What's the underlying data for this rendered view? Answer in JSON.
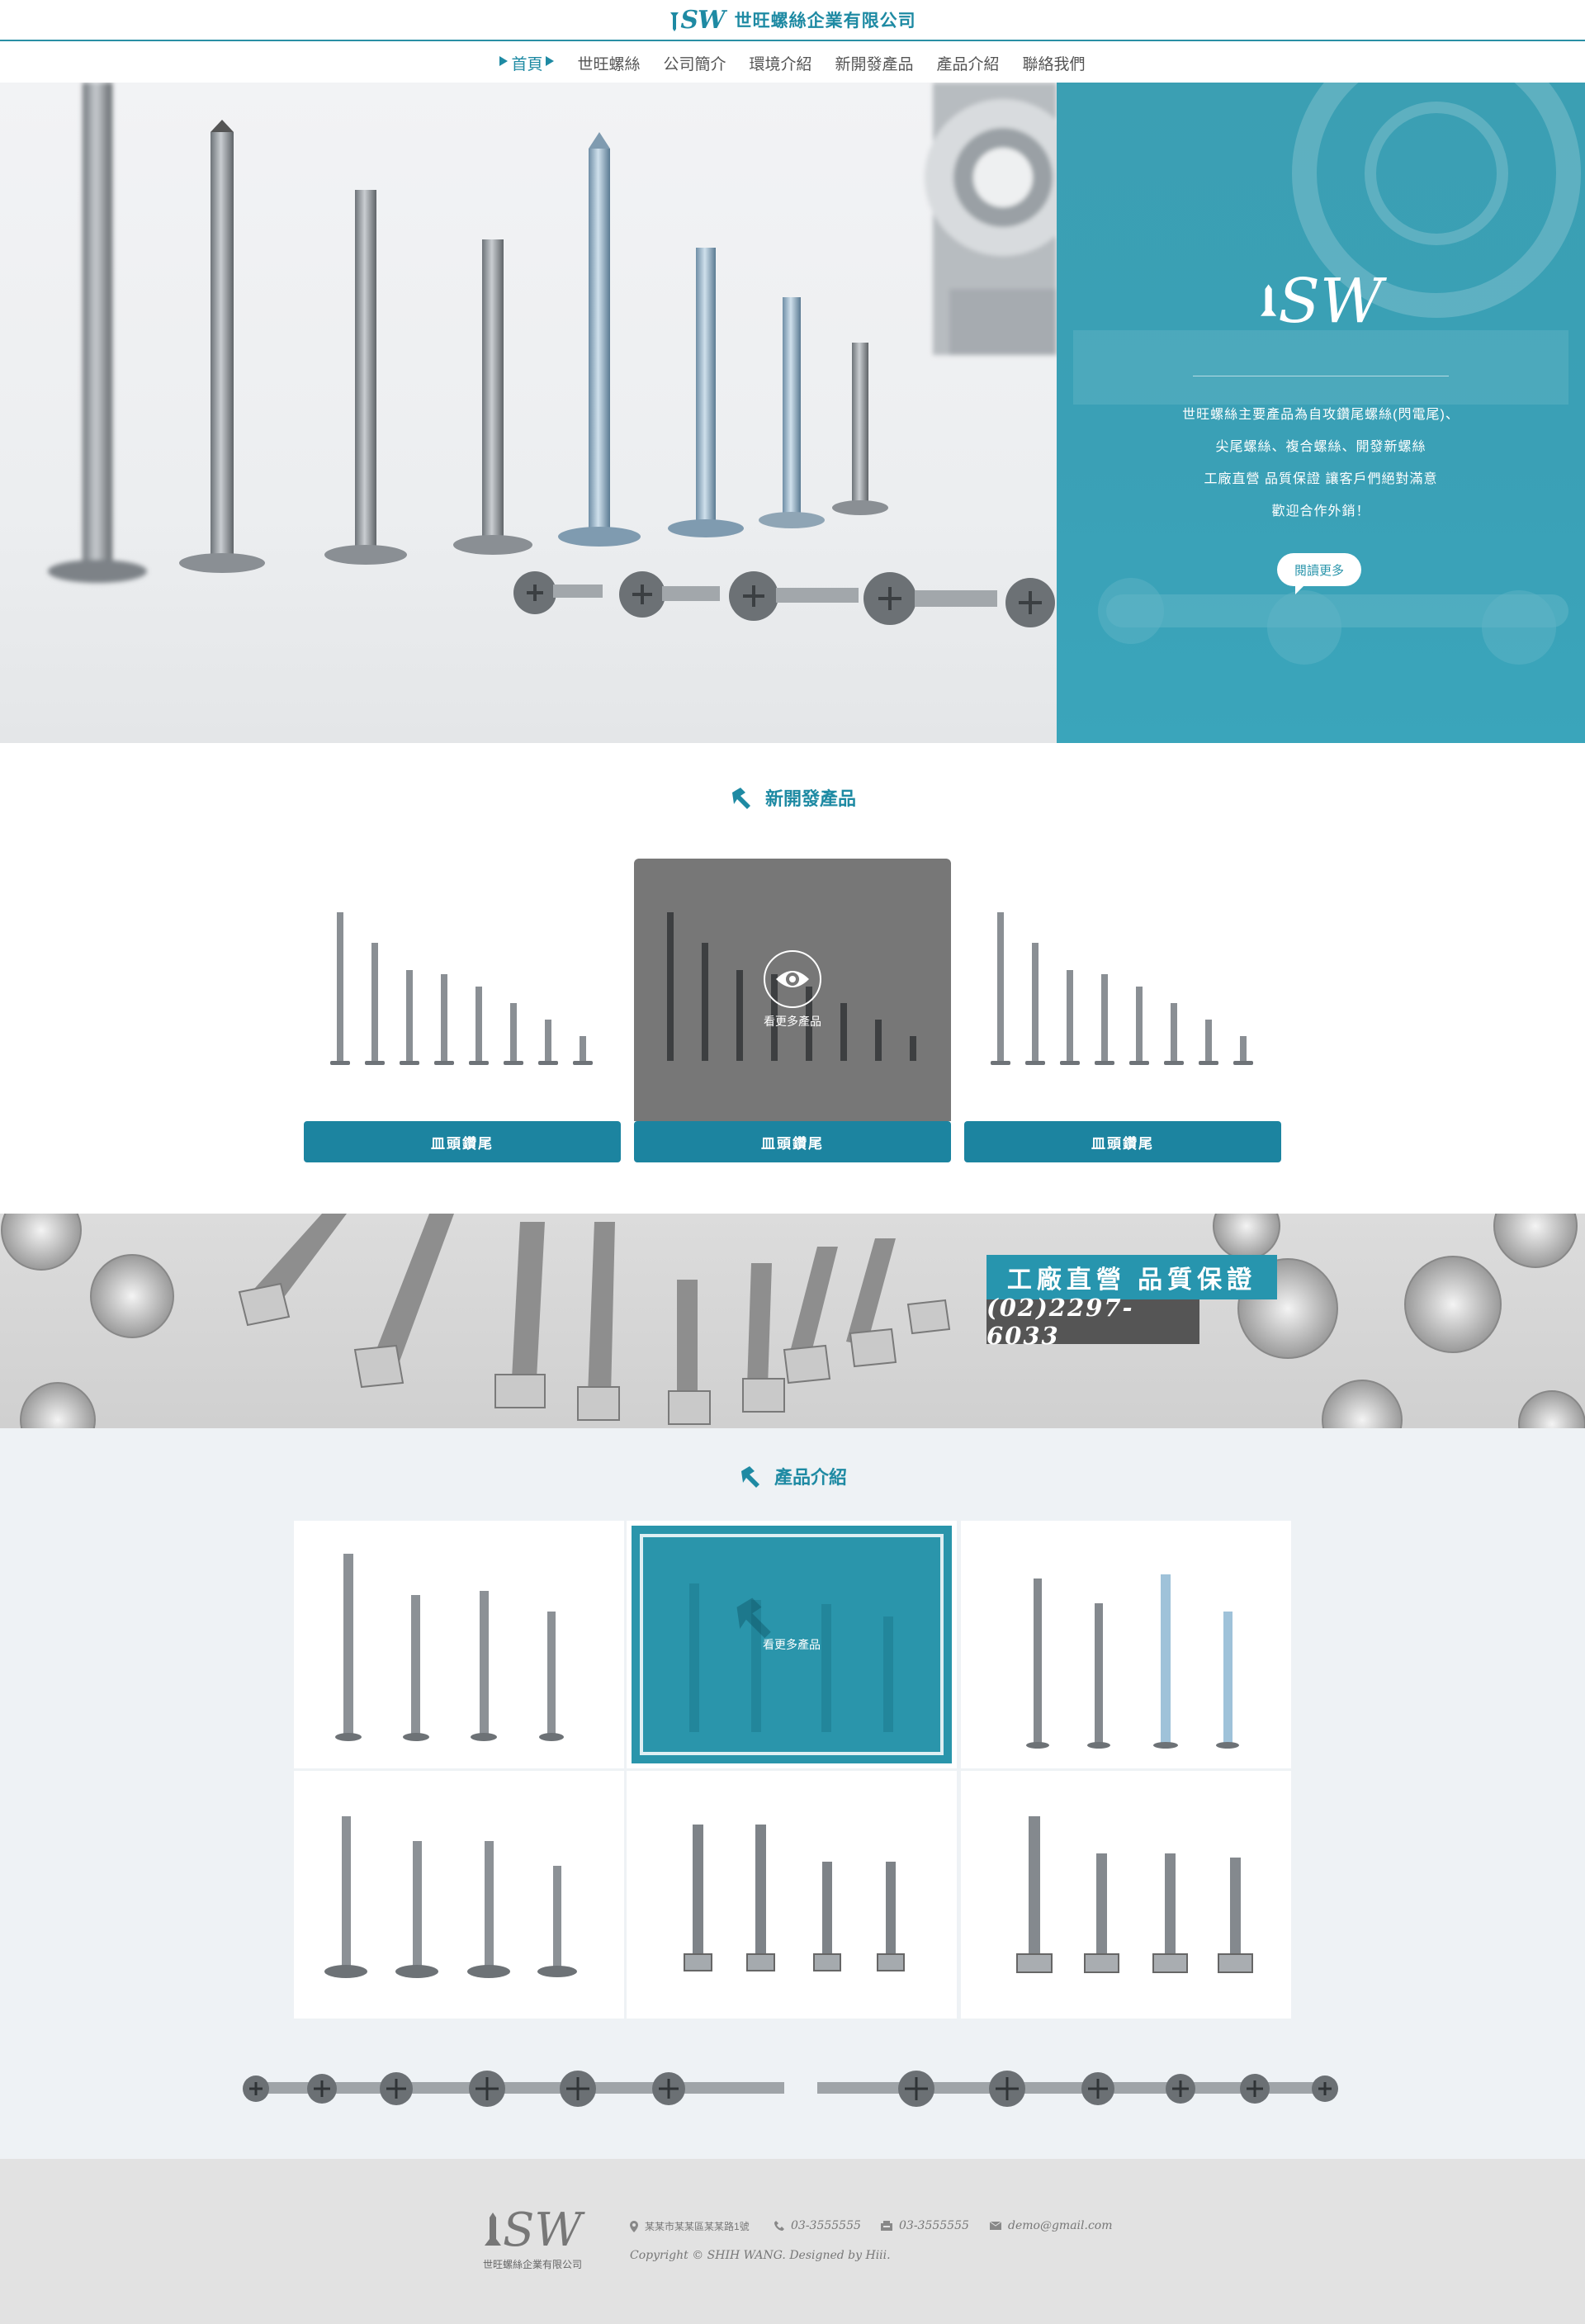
{
  "header": {
    "logo_text": "SW",
    "company": "世旺螺絲企業有限公司"
  },
  "nav": {
    "items": [
      "首頁",
      "世旺螺絲",
      "公司簡介",
      "環境介紹",
      "新開發產品",
      "產品介紹",
      "聯絡我們"
    ]
  },
  "hero": {
    "logo_text": "SW",
    "lines": [
      "世旺螺絲主要產品為自攻鑽尾螺絲(閃電尾)、",
      "尖尾螺絲、複合螺絲、開發新螺絲",
      "工廠直營 品質保證 讓客戶們絕對滿意",
      "歡迎合作外銷！"
    ],
    "button": "閱讀更多"
  },
  "new_products": {
    "title": "新開發產品",
    "hover_text": "看更多產品",
    "cards": [
      {
        "label": "皿頭鑽尾"
      },
      {
        "label": "皿頭鑽尾"
      },
      {
        "label": "皿頭鑽尾"
      }
    ]
  },
  "banner": {
    "tag": "工廠直營  品質保證",
    "phone": "(02)2297-6033"
  },
  "products": {
    "title": "產品介紹",
    "hover_text": "看更多產品"
  },
  "footer": {
    "logo_text": "SW",
    "company": "世旺螺絲企業有限公司",
    "address": "某某市某某區某某路1號",
    "phone": "03-3555555",
    "fax": "03-3555555",
    "email": "demo@gmail.com",
    "copyright": "Copyright © SHIH WANG. Designed by Hiii."
  },
  "colors": {
    "accent": "#1e8aa3",
    "panel": "#3a9fb5",
    "footer_bg": "#e2e2e2"
  }
}
